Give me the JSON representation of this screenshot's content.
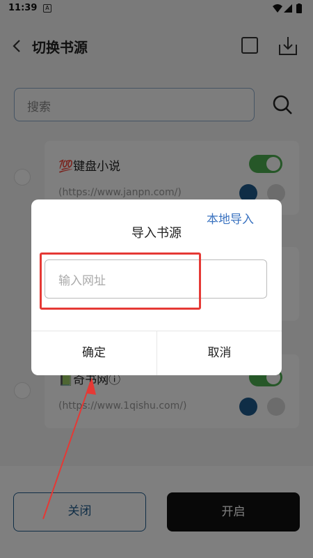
{
  "status_bar": {
    "time": "11:39",
    "app_icon_letter": "A"
  },
  "header": {
    "title": "切换书源",
    "icons": [
      "back-icon",
      "select-all-icon",
      "download-icon"
    ]
  },
  "search": {
    "placeholder": "搜索"
  },
  "sources": [
    {
      "name": "💯键盘小说",
      "url": "(https://www.janpn.com/)",
      "enabled": true
    },
    {
      "name": "📗奇书网ⓘ",
      "url": "(https://www.1qishu.com/)",
      "enabled": true
    }
  ],
  "bottom": {
    "close_label": "关闭",
    "open_label": "开启"
  },
  "dialog": {
    "title": "导入书源",
    "input_placeholder": "输入网址",
    "local_import_label": "本地导入",
    "ok_label": "确定",
    "cancel_label": "取消"
  },
  "colors": {
    "accent": "#1f5a8c",
    "highlight": "#e53935",
    "toggle_on": "#4caf50",
    "link": "#3b73c0"
  }
}
